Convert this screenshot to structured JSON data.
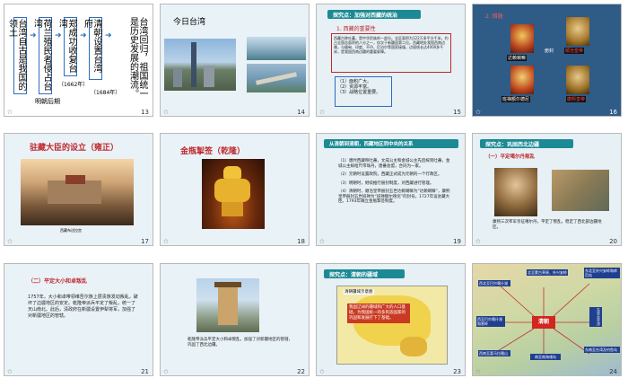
{
  "slides": [
    {
      "num": "13",
      "col1": "台湾自古是我国的领土",
      "col2": "荷兰殖民者侵占台湾",
      "col3": "郑成功收复台湾",
      "col4": "清朝设置台湾府",
      "col5": "台湾回归，祖国统一是历史发展的潮流。",
      "era": "明朝后期",
      "year1": "（1662年）",
      "year2": "（1684年）"
    },
    {
      "num": "14",
      "title": "今日台湾"
    },
    {
      "num": "15",
      "explore": "探究点：加强对西藏的统治",
      "sub": "1. 西藏的重要性",
      "para": "西藏古称吐蕃，是中华民族的一部分。全区面积为122万多平方千米，约占全国总面积的八分之一，仅次于新疆居第二位。西藏地处我国西南边陲，与缅甸、印度、不丹、尼泊尔等国家接壤，边境线长达4000多千米，是我国西南边疆的重要屏障。",
      "points": [
        "（1）面积广大。",
        "（2）资源丰富。",
        "（3）战略位置重要。"
      ]
    },
    {
      "num": "16",
      "title": "2. 措施",
      "labels": [
        "达赖喇嘛",
        "册封",
        "顺治皇帝",
        "班禅额尔德尼",
        "康熙皇帝"
      ]
    },
    {
      "num": "17",
      "title": "驻藏大臣的设立（雍正）",
      "caption": "西藏布达拉宫"
    },
    {
      "num": "18",
      "title": "金瓶掣签（乾隆）"
    },
    {
      "num": "19",
      "header": "从清朝到清朝，西藏地区同中央的关系",
      "items": [
        "（1）唐时西藏称吐蕃，文成公主和金城公主先后嫁到吐蕃，金城公主嫁给尺带珠丹，唐蕃会盟，合同为一家。",
        "（2）元朝时设置政院，西藏正式成为元朝的一个行政区。",
        "（3）明朝时，继续推行册封制度，对西藏进行管理。",
        "（4）清朝时，顺治皇帝册封五世达赖喇嘛为“达赖喇嘛”，康熙皇帝册封五世班禅为“班禅额尔德尼”的封号。1727年设驻藏大臣。1793年确立金瓶掣签制度。"
      ]
    },
    {
      "num": "20",
      "explore": "探究点：巩固西北边疆",
      "sub": "（一）平定噶尔丹叛乱",
      "caption": "康熙三次率军亲征噶尔丹，平定了叛乱，稳定了西北部边疆地区。"
    },
    {
      "num": "21",
      "sub": "（二）平定大小和卓叛乱",
      "para": "1757年，大小和卓带领维吾尔族上层贵族发动叛乱，破坏了边疆地区的安定。乾隆帝派兵平定了叛乱，统一了天山南北。此后，清政府在新疆设置伊犁将军，加强了对新疆地区的管辖。"
    },
    {
      "num": "22",
      "caption": "乾隆帝派兵平定大小和卓叛乱，加强了对新疆地区的管辖，巩固了西北边疆。"
    },
    {
      "num": "23",
      "explore": "探究点：清朝的疆域",
      "legend": "清朝疆域示意图",
      "note": "我国辽阔的疆域和广大的人口基础，为我国统一的多民族国家的巩固和发展打下了基础。"
    },
    {
      "num": "24",
      "center": "清朝",
      "north": "北至蒙古草原、外兴安岭",
      "south": "南至南海诸岛",
      "east": "东至太平洋",
      "west": "西至巴尔喀什湖和葱岭",
      "ne": "东北至外兴安岭和库页岛",
      "se": "东南至台湾及钓鱼岛",
      "nw": "西北至巴尔喀什湖",
      "sw": "西南至喜马拉雅山"
    }
  ]
}
